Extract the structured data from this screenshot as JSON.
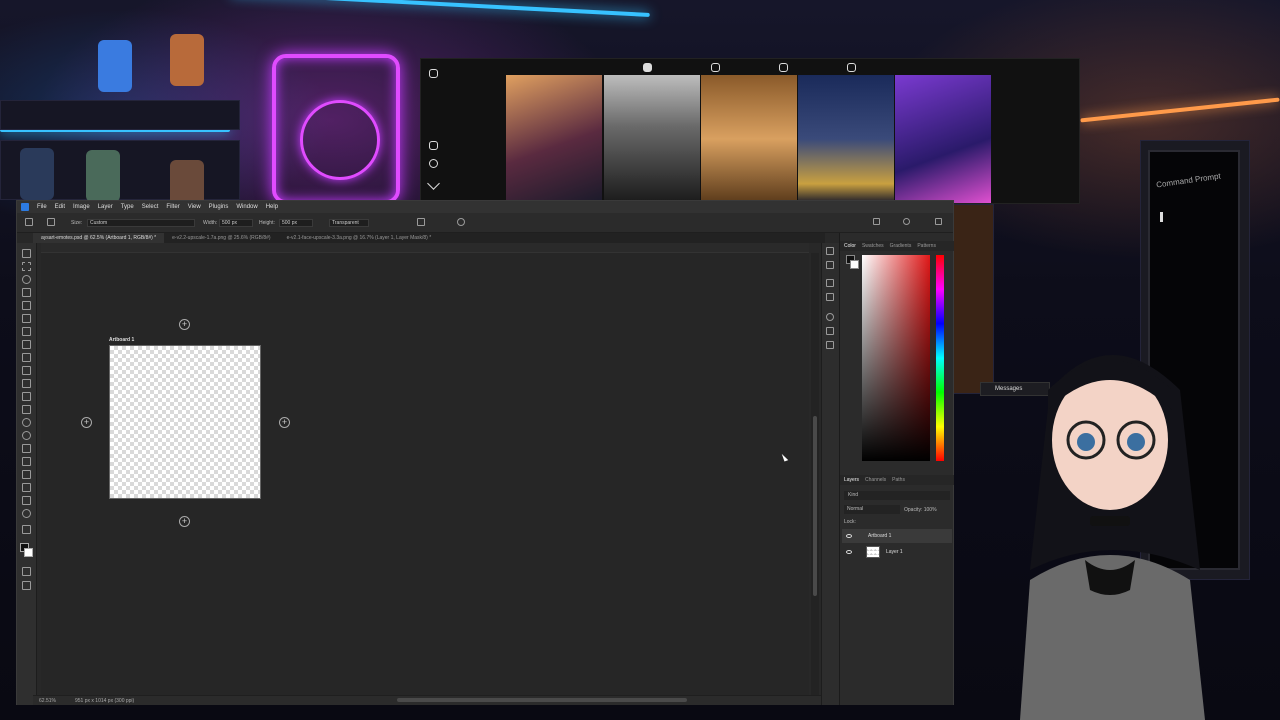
{
  "photoshop": {
    "menu": [
      "File",
      "Edit",
      "Image",
      "Layer",
      "Type",
      "Select",
      "Filter",
      "View",
      "Plugins",
      "Window",
      "Help"
    ],
    "options": {
      "size_label": "Size:",
      "size_value": "Custom",
      "width_label": "Width:",
      "width_value": "500 px",
      "height_label": "Height:",
      "height_value": "500 px",
      "background_value": "Transparent"
    },
    "tabs": [
      "aysart-emotes.psd @ 62.5% (Artboard 1, RGB/8#) *",
      "e-v2.2-upscale-1.7a.png @ 25.6% (RGB/8#)",
      "e-v2.1-face-upscale-3.3a.png @ 16.7% (Layer 1, Layer Mask/8) *"
    ],
    "artboard_label": "Artboard 1",
    "status": {
      "zoom": "62.51%",
      "dimensions": "951 px x 1014 px (300 ppi)"
    },
    "color_panel_tabs": [
      "Color",
      "Swatches",
      "Gradients",
      "Patterns"
    ],
    "layers_panel_tabs": [
      "Layers",
      "Channels",
      "Paths"
    ],
    "layers": {
      "search": "Kind",
      "blend_mode": "Normal",
      "opacity": "Opacity: 100%",
      "lock": "Lock:",
      "items": [
        "Artboard 1",
        "Layer 1"
      ]
    }
  },
  "gallery": {
    "thumb_colors": [
      "#c96a3a",
      "#7c7c7c",
      "#b9793f",
      "#1b2a4a",
      "#3b2a7a"
    ]
  },
  "terminal": {
    "title": "Command Prompt"
  },
  "messages_widget": {
    "label": "Messages"
  },
  "colors": {
    "accent_neon_pink": "#e04bff",
    "accent_neon_blue": "#2bb6ff",
    "ps_blue": "#2d7be0"
  }
}
